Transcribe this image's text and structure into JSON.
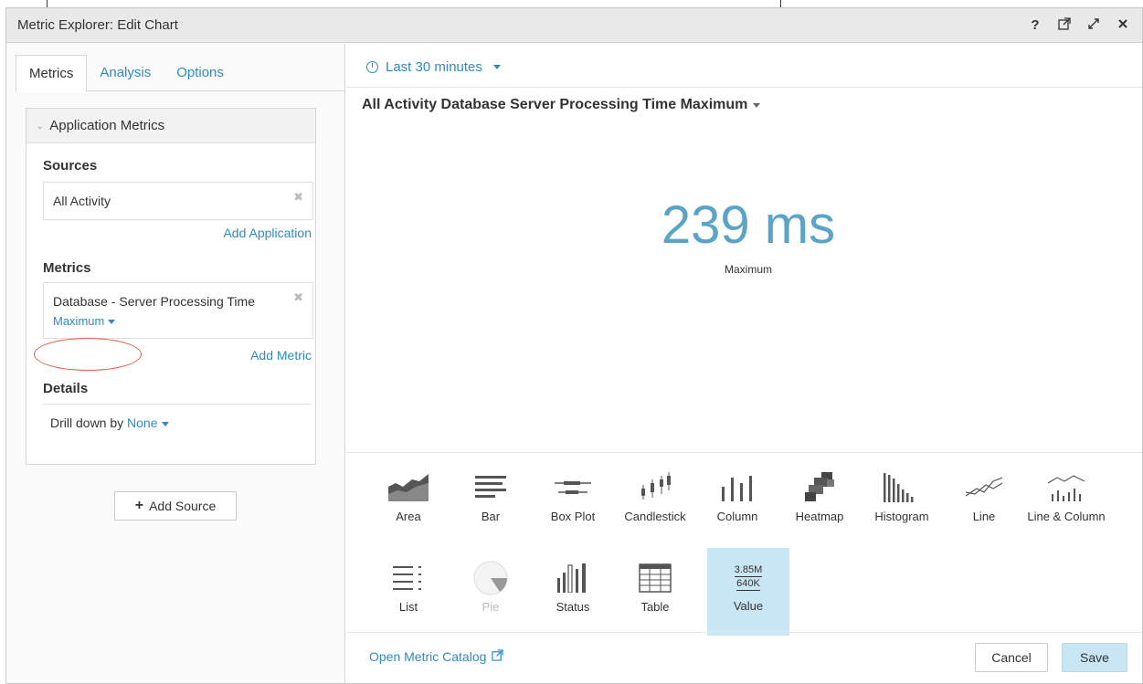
{
  "window": {
    "title": "Metric Explorer: Edit Chart",
    "icons": [
      "help-icon",
      "external-link-icon",
      "expand-icon",
      "close-icon"
    ],
    "help_glyph": "?"
  },
  "left": {
    "tabs": [
      {
        "label": "Metrics",
        "active": true
      },
      {
        "label": "Analysis",
        "active": false
      },
      {
        "label": "Options",
        "active": false
      }
    ],
    "app_box": {
      "header": "Application Metrics",
      "sources_label": "Sources",
      "source_value": "All Activity",
      "add_application": "Add Application",
      "metrics_label": "Metrics",
      "metric_value": "Database - Server Processing Time",
      "metric_aggregation": "Maximum",
      "add_metric": "Add Metric",
      "details_label": "Details",
      "drill_prefix": "Drill down by",
      "drill_value": "None"
    },
    "add_source": "Add Source"
  },
  "right": {
    "time_range": "Last 30 minutes",
    "chart_title": "All Activity Database Server Processing Time Maximum",
    "value": "239 ms",
    "value_label": "Maximum",
    "chart_types": [
      {
        "label": "Area",
        "icon": "area-chart-icon"
      },
      {
        "label": "Bar",
        "icon": "bar-chart-icon"
      },
      {
        "label": "Box Plot",
        "icon": "box-plot-icon"
      },
      {
        "label": "Candlestick",
        "icon": "candlestick-icon"
      },
      {
        "label": "Column",
        "icon": "column-chart-icon"
      },
      {
        "label": "Heatmap",
        "icon": "heatmap-icon"
      },
      {
        "label": "Histogram",
        "icon": "histogram-icon"
      },
      {
        "label": "Line",
        "icon": "line-chart-icon"
      },
      {
        "label": "Line & Column",
        "icon": "line-column-icon"
      },
      {
        "label": "List",
        "icon": "list-icon"
      },
      {
        "label": "Pie",
        "icon": "pie-chart-icon",
        "disabled": true
      },
      {
        "label": "Status",
        "icon": "status-icon"
      },
      {
        "label": "Table",
        "icon": "table-icon"
      },
      {
        "label": "Value",
        "icon": "value-icon",
        "selected": true
      }
    ],
    "value_icon_top": "3.85M",
    "value_icon_bottom": "640K",
    "open_catalog": "Open Metric Catalog",
    "cancel": "Cancel",
    "save": "Save"
  },
  "colors": {
    "accent": "#2e8bc0",
    "value": "#5ba4c8",
    "selected_bg": "#c9e6f5",
    "highlight_ring": "#e25a3a"
  }
}
